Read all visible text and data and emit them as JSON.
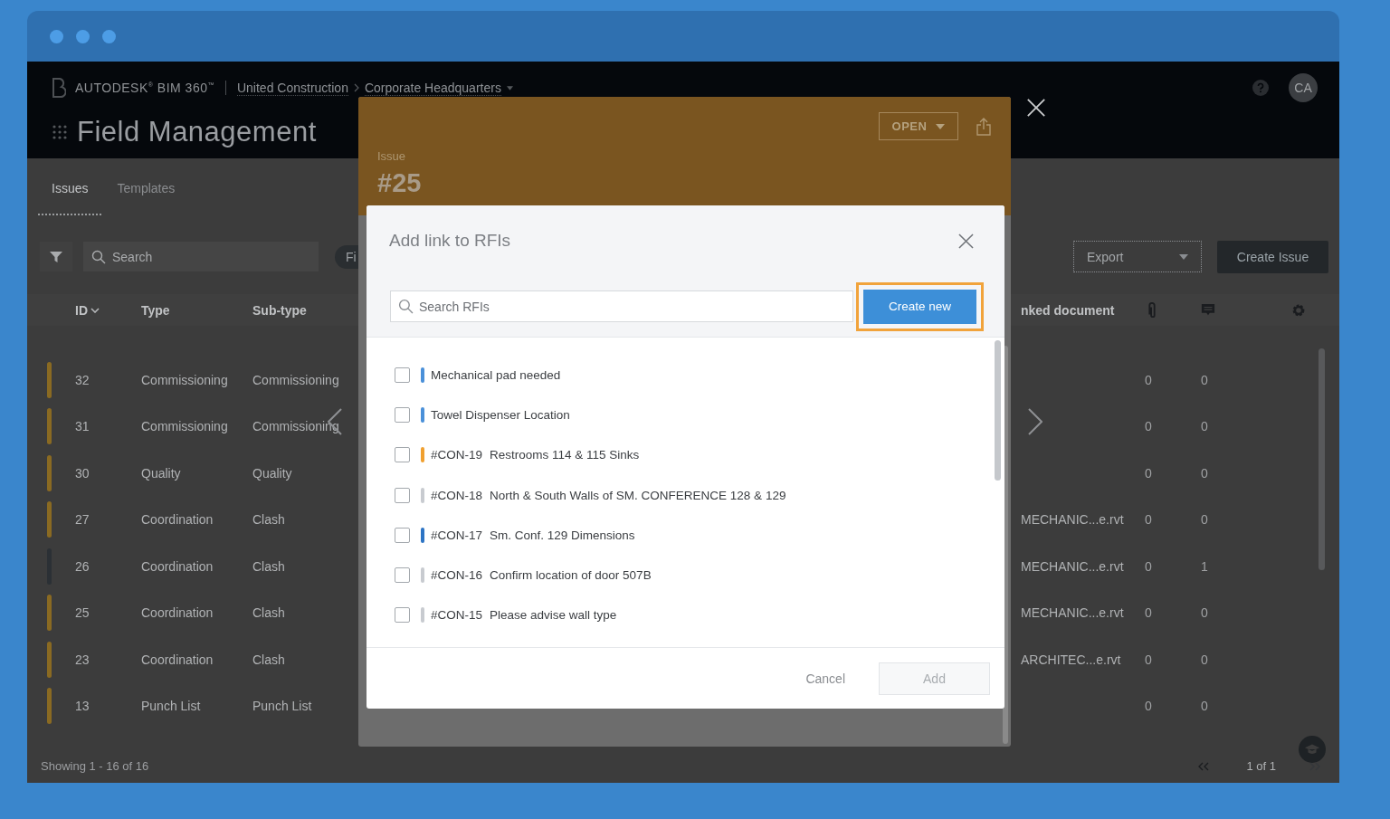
{
  "header": {
    "brand": "AUTODESK$^{®}$ BIM 360$^{™}$",
    "breadcrumb": [
      "United Construction",
      "Corporate Headquarters"
    ],
    "title": "Field Management",
    "avatar": "CA"
  },
  "tabs": [
    {
      "label": "Issues",
      "selected": true
    },
    {
      "label": "Templates",
      "selected": false
    }
  ],
  "toolbar": {
    "search": {
      "placeholder": "Search"
    },
    "filter_chip": "Fi",
    "export": "Export",
    "create": "Create Issue"
  },
  "table": {
    "columns": [
      "ID",
      "Type",
      "Sub-type",
      "nked document"
    ],
    "rows": [
      {
        "id": "32",
        "type": "Commissioning",
        "subtype": "Commissioning",
        "attachments": "0",
        "comments": "0",
        "color": "#8a6a22"
      },
      {
        "id": "31",
        "type": "Commissioning",
        "subtype": "Commissioning",
        "attachments": "0",
        "comments": "0",
        "color": "#8a6a22"
      },
      {
        "id": "30",
        "type": "Quality",
        "subtype": "Quality",
        "attachments": "0",
        "comments": "0",
        "color": "#8a6a22"
      },
      {
        "id": "27",
        "type": "Coordination",
        "subtype": "Clash",
        "document": "MECHANIC...e.rvt",
        "attachments": "0",
        "comments": "0",
        "color": "#8a6a22"
      },
      {
        "id": "26",
        "type": "Coordination",
        "subtype": "Clash",
        "document": "MECHANIC...e.rvt",
        "attachments": "0",
        "comments": "1",
        "color": "#2b3035"
      },
      {
        "id": "25",
        "type": "Coordination",
        "subtype": "Clash",
        "document": "MECHANIC...e.rvt",
        "attachments": "0",
        "comments": "0",
        "color": "#8a6a22"
      },
      {
        "id": "23",
        "type": "Coordination",
        "subtype": "Clash",
        "document": "ARCHITEC...e.rvt",
        "attachments": "0",
        "comments": "0",
        "color": "#8a6a22"
      },
      {
        "id": "13",
        "type": "Punch List",
        "subtype": "Punch List",
        "attachments": "0",
        "comments": "0",
        "color": "#8a6a22"
      }
    ]
  },
  "footer": {
    "showing": "Showing 1 - 16 of 16",
    "pages": "1 of 1"
  },
  "issue": {
    "label": "Issue",
    "number": "#25",
    "status": "OPEN"
  },
  "dialog": {
    "title": "Add link to RFIs",
    "search": {
      "placeholder": "Search RFIs"
    },
    "create": "Create new",
    "items": [
      {
        "title": "Mechanical pad needed",
        "color": "#4a90d9",
        "checked": false
      },
      {
        "title": "Towel Dispenser Location",
        "color": "#4a90d9",
        "checked": false
      },
      {
        "code": "#CON-19",
        "title": "Restrooms 114 & 115 Sinks",
        "color": "#f0a030",
        "checked": false
      },
      {
        "code": "#CON-18",
        "title": "North & South Walls of SM. CONFERENCE 128 & 129",
        "color": "#c8cbd0",
        "checked": false
      },
      {
        "code": "#CON-17",
        "title": "Sm. Conf. 129 Dimensions",
        "color": "#2d74c4",
        "checked": false
      },
      {
        "code": "#CON-16",
        "title": "Confirm location of door 507B",
        "color": "#c8cbd0",
        "checked": false
      },
      {
        "code": "#CON-15",
        "title": "Please advise wall type",
        "color": "#c8cbd0",
        "checked": false
      }
    ],
    "cancel": "Cancel",
    "add": {
      "label": "Add",
      "disabled": true
    }
  }
}
